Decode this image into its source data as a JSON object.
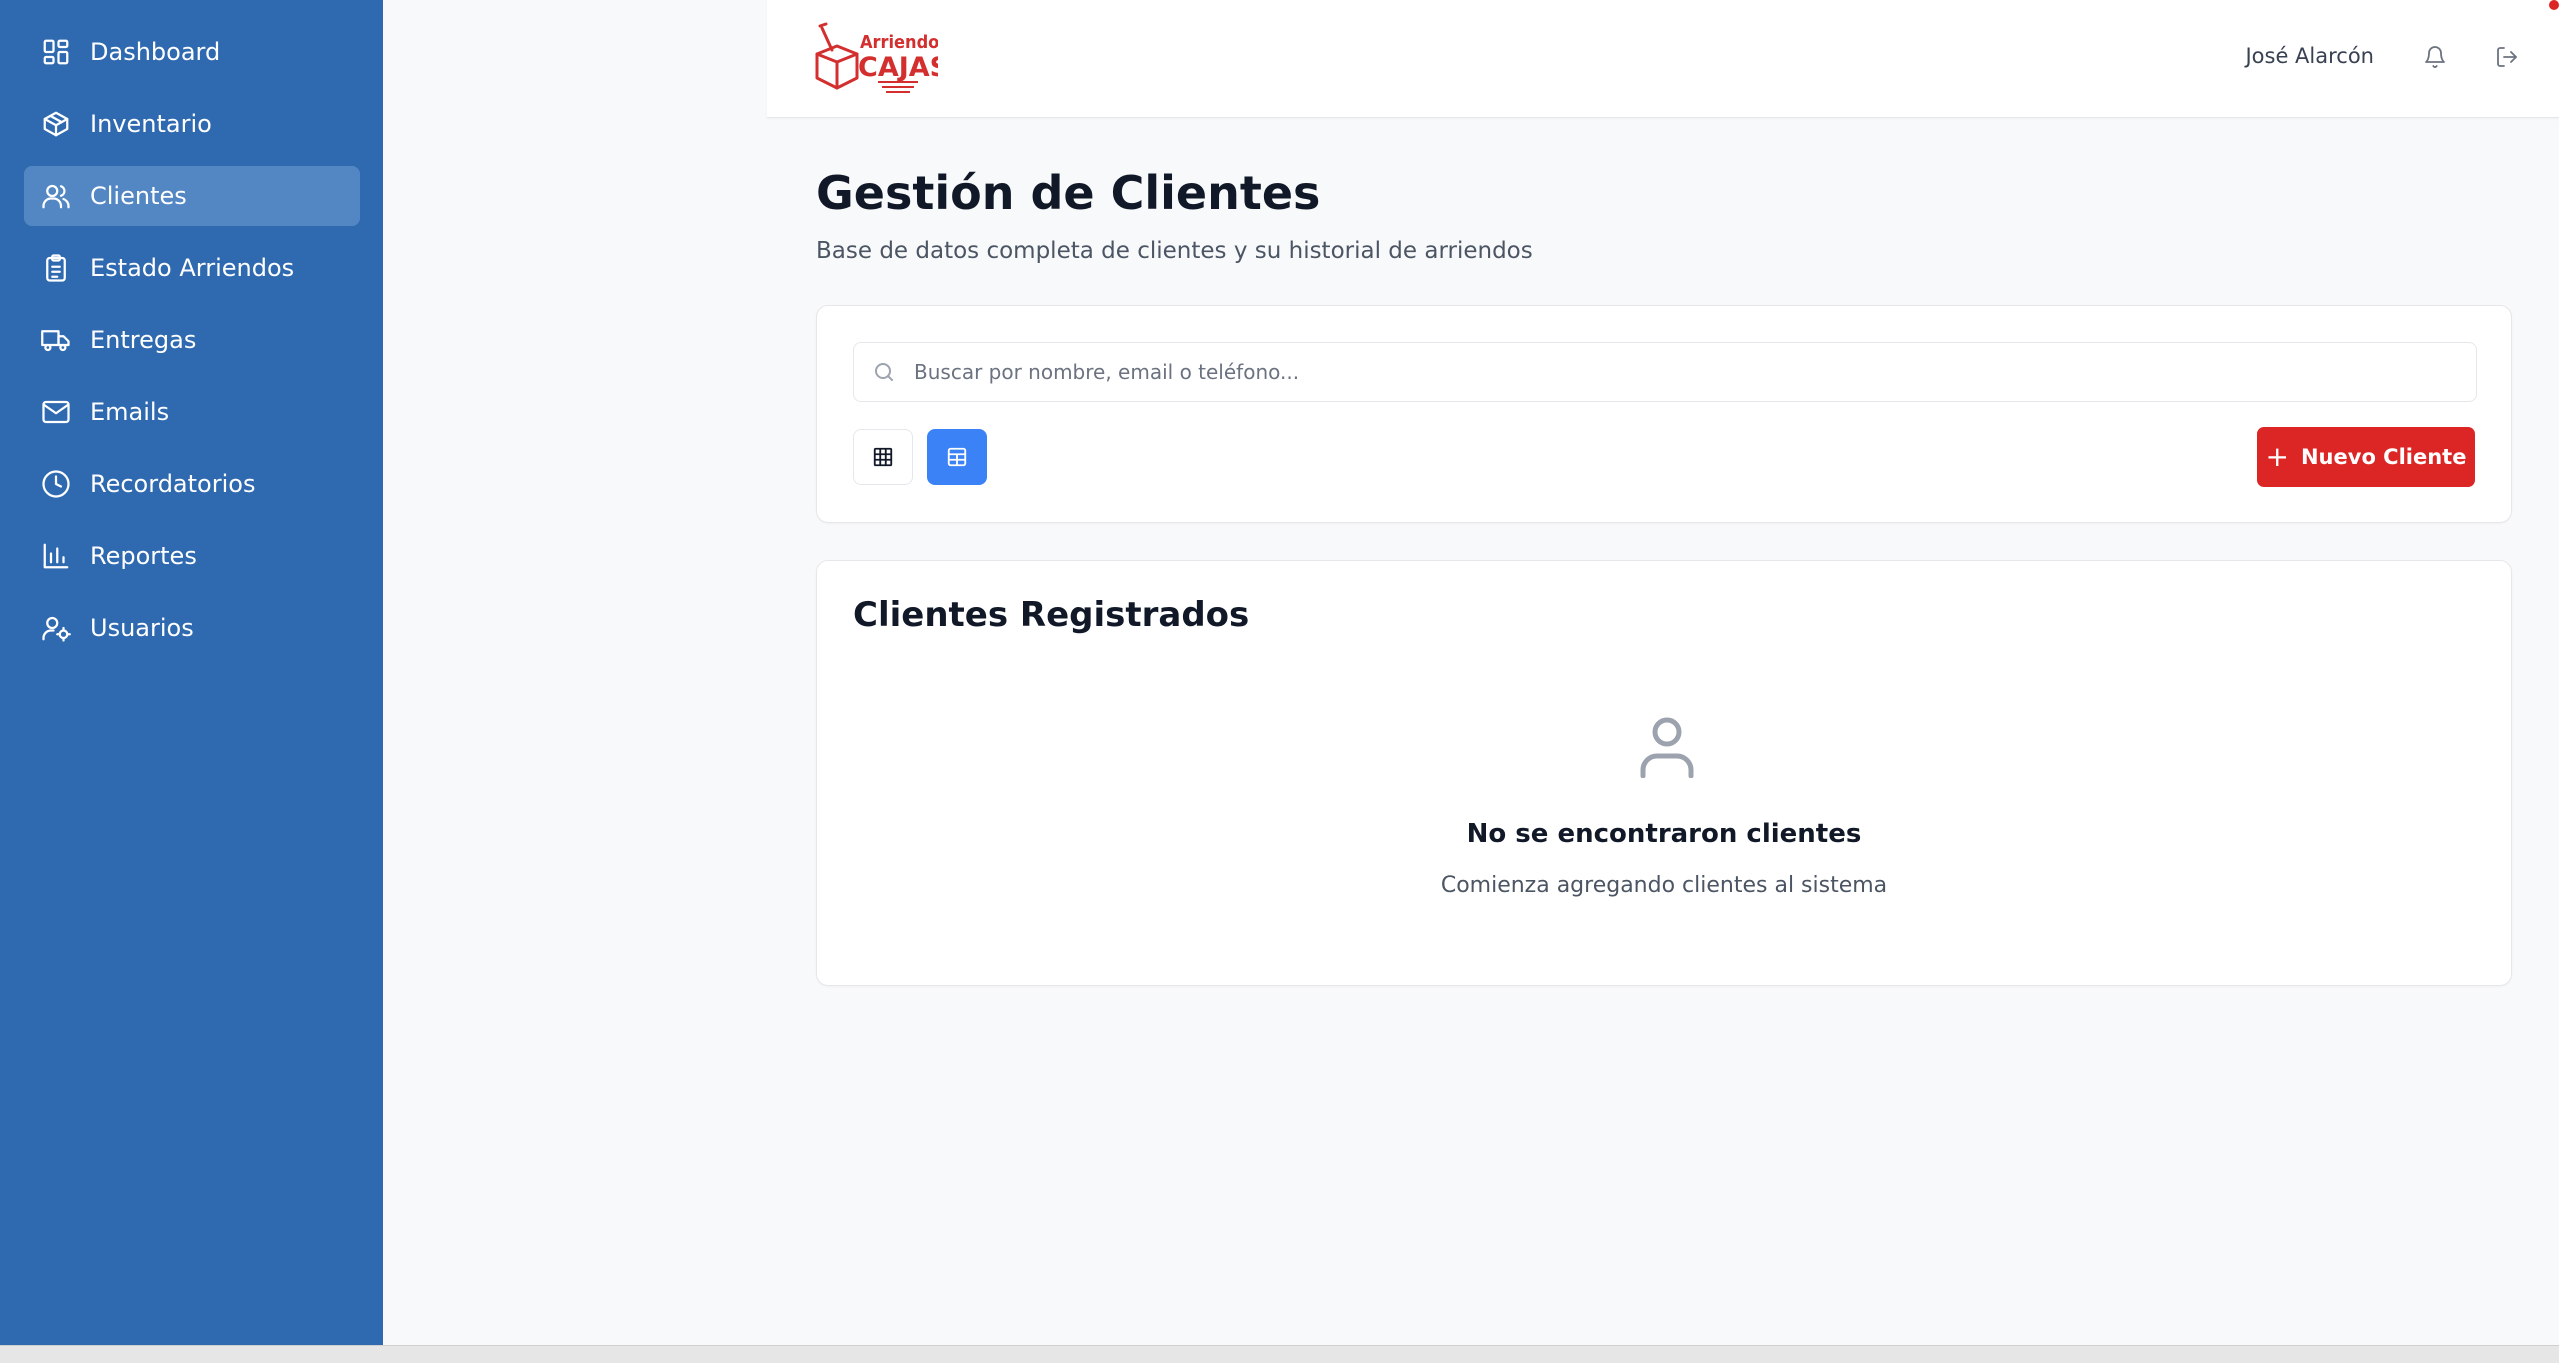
{
  "sidebar": {
    "items": [
      {
        "label": "Dashboard",
        "icon": "dashboard-icon",
        "active": false
      },
      {
        "label": "Inventario",
        "icon": "box-icon",
        "active": false
      },
      {
        "label": "Clientes",
        "icon": "users-icon",
        "active": true
      },
      {
        "label": "Estado Arriendos",
        "icon": "clipboard-icon",
        "active": false
      },
      {
        "label": "Entregas",
        "icon": "truck-icon",
        "active": false
      },
      {
        "label": "Emails",
        "icon": "mail-icon",
        "active": false
      },
      {
        "label": "Recordatorios",
        "icon": "clock-icon",
        "active": false
      },
      {
        "label": "Reportes",
        "icon": "bar-chart-icon",
        "active": false
      },
      {
        "label": "Usuarios",
        "icon": "user-cog-icon",
        "active": false
      }
    ]
  },
  "header": {
    "logo_text_top": "Arriendo",
    "logo_text_bottom": "CAJAS",
    "user_name": "José Alarcón"
  },
  "page": {
    "title": "Gestión de Clientes",
    "subtitle": "Base de datos completa de clientes y su historial de arriendos"
  },
  "search": {
    "placeholder": "Buscar por nombre, email o teléfono...",
    "value": ""
  },
  "toolbar": {
    "new_client_label": "Nuevo Cliente",
    "active_view": "table"
  },
  "clients_card": {
    "title": "Clientes Registrados",
    "empty_title": "No se encontraron clientes",
    "empty_subtitle": "Comienza agregando clientes al sistema"
  },
  "colors": {
    "sidebar_bg": "#2f6ab0",
    "sidebar_active": "#5287c4",
    "accent_red": "#dc2626",
    "accent_blue": "#3b82f6"
  }
}
